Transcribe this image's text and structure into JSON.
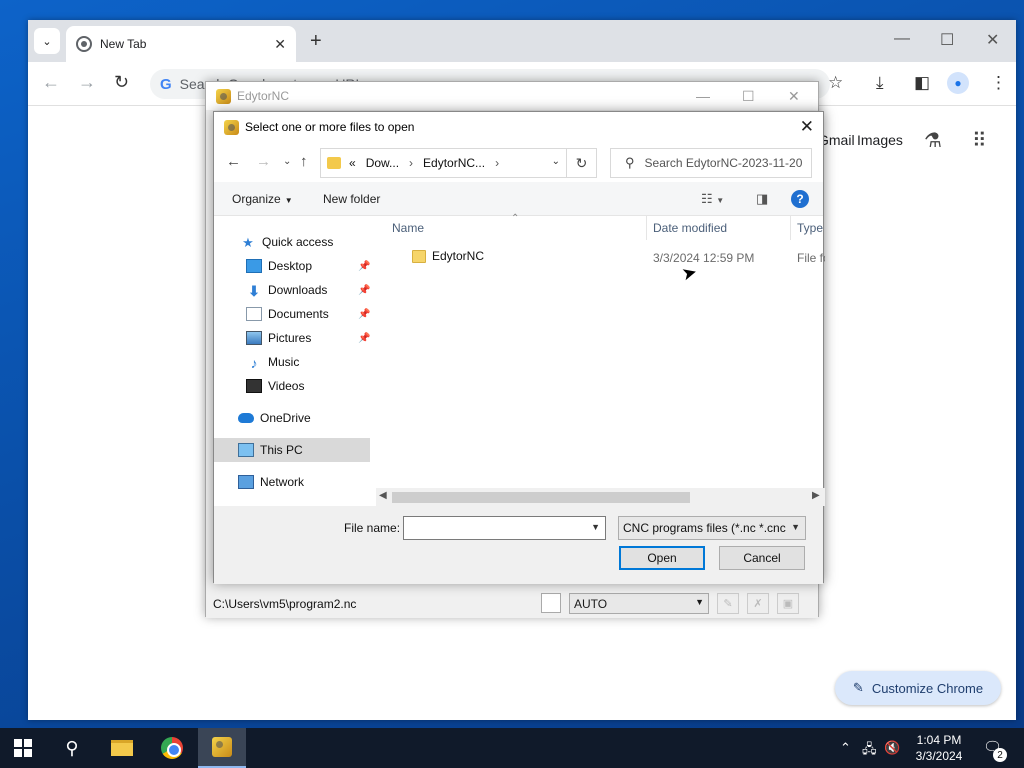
{
  "chrome": {
    "tab_title": "New Tab",
    "omnibox_text": "Search Google or type a URL",
    "ntp_links": [
      "Gmail",
      "Images"
    ],
    "customize_label": "Customize Chrome"
  },
  "edytor": {
    "title": "EdytorNC",
    "status_path": "C:\\Users\\vm5\\program2.nc",
    "status_combo": "AUTO"
  },
  "dialog": {
    "title": "Select one or more files to open",
    "address": {
      "prefix": "«",
      "segments": [
        "Dow...",
        "EdytorNC..."
      ]
    },
    "search_placeholder": "Search EdytorNC-2023-11-20",
    "toolbar": {
      "organize": "Organize",
      "new_folder": "New folder"
    },
    "nav_items": [
      {
        "label": "Quick access",
        "icon": "star-icon"
      },
      {
        "label": "Desktop",
        "icon": "desktop-icon"
      },
      {
        "label": "Downloads",
        "icon": "download-icon"
      },
      {
        "label": "Documents",
        "icon": "document-icon"
      },
      {
        "label": "Pictures",
        "icon": "pictures-icon"
      },
      {
        "label": "Music",
        "icon": "music-icon"
      },
      {
        "label": "Videos",
        "icon": "video-icon"
      },
      {
        "label": "OneDrive",
        "icon": "cloud-icon"
      },
      {
        "label": "This PC",
        "icon": "pc-icon",
        "selected": true
      },
      {
        "label": "Network",
        "icon": "network-icon"
      }
    ],
    "columns": {
      "name": "Name",
      "date": "Date modified",
      "type": "Type"
    },
    "files": [
      {
        "name": "EdytorNC",
        "date": "3/3/2024 12:59 PM",
        "type": "File folder"
      }
    ],
    "file_name_label": "File name:",
    "file_name_value": "",
    "filter": "CNC programs files (*.nc *.cnc",
    "open_label": "Open",
    "cancel_label": "Cancel"
  },
  "taskbar": {
    "time": "1:04 PM",
    "date": "3/3/2024",
    "notifications": "2"
  },
  "colors": {
    "accent": "#0078d7",
    "desktop": "#0a4fa8",
    "taskbar": "#101a2a"
  }
}
